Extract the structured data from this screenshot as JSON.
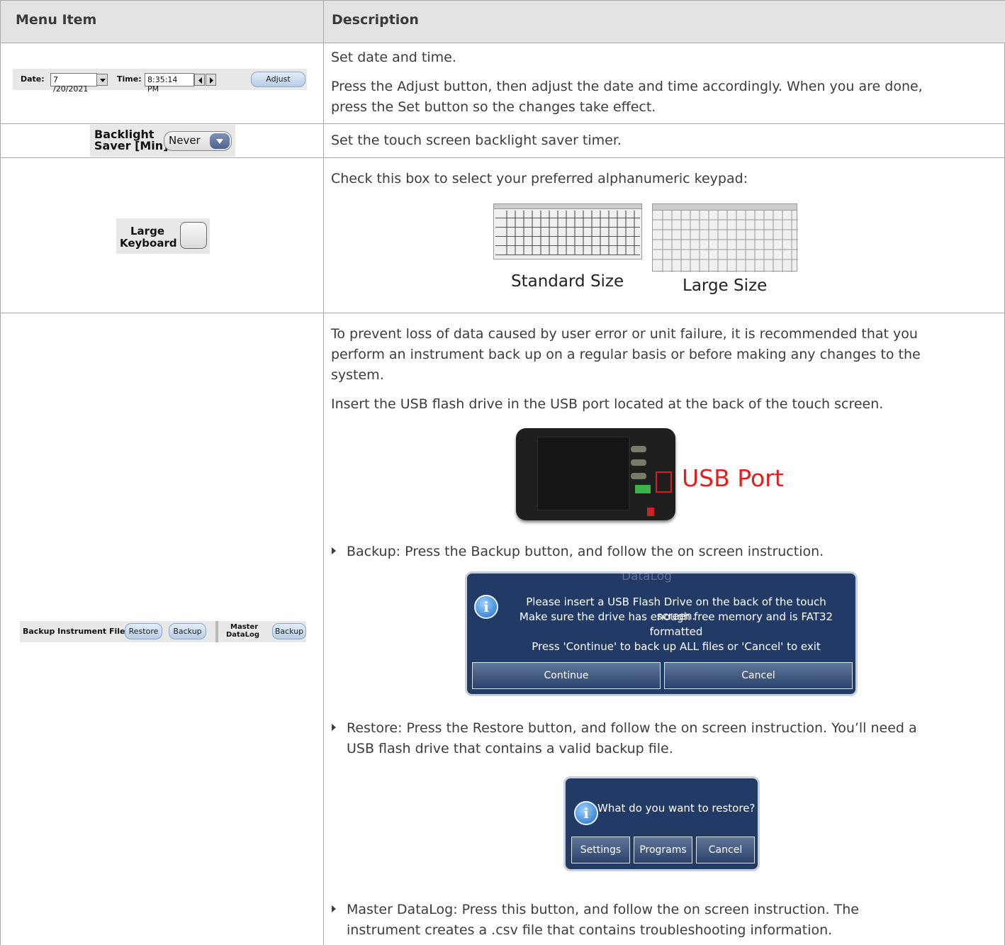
{
  "header": {
    "col1": "Menu Item",
    "col2": "Description"
  },
  "row_datetime": {
    "date_label": "Date:",
    "date_value": "7 /20/2021",
    "time_label": "Time:",
    "time_value": "8:35:14 PM",
    "adjust_label": "Adjust",
    "desc1": "Set date and time.",
    "desc2_line1": "Press the Adjust button, then adjust the date and time accordingly. When you are done,",
    "desc2_line2": "press the Set button so the changes take effect."
  },
  "row_backlight": {
    "label_line1": "Backlight",
    "label_line2": "Saver [Min]:",
    "value": "Never",
    "desc": "Set the touch screen backlight saver timer."
  },
  "row_keyboard": {
    "label_line1": "Large",
    "label_line2": "Keyboard",
    "desc": "Check this box to select your preferred alphanumeric keypad:",
    "standard_caption": "Standard Size",
    "large_caption": "Large Size"
  },
  "row_backup": {
    "label": "Backup Instrument Files:",
    "restore_label": "Restore",
    "backup_label": "Backup",
    "master_line1": "Master",
    "master_line2": "DataLog",
    "master_backup_label": "Backup",
    "p1_line1": "To prevent loss of data caused by user error or unit failure, it is recommended that you",
    "p1_line2": "perform an instrument back up on a regular basis or before making any changes to the",
    "p1_line3": "system.",
    "p2": "Insert the USB flash drive in the USB port located at the back of the touch screen.",
    "usb_label": "USB Port",
    "bullet_backup": "Backup: Press the Backup button, and follow the on screen instruction.",
    "dialog1": {
      "line1": "Please insert a USB Flash Drive on the back of the touch screen.",
      "line2": "Make sure the drive has enough free memory and is FAT32",
      "line3": "formatted",
      "line4": "Press 'Continue' to back up ALL files or 'Cancel' to exit",
      "continue_label": "Continue",
      "cancel_label": "Cancel"
    },
    "bullet_restore_line1": "Restore: Press the Restore button, and follow the on screen instruction. You’ll need a",
    "bullet_restore_line2": "USB flash drive that contains a valid backup file.",
    "dialog2": {
      "question": "What do you want to restore?",
      "settings_label": "Settings",
      "programs_label": "Programs",
      "cancel_label": "Cancel"
    },
    "bullet_master_line1": "Master DataLog: Press this button, and follow the on screen instruction. The",
    "bullet_master_line2": "instrument creates a .csv file that contains troubleshooting information."
  },
  "icons": {
    "bullet": "triangle-bullet-icon",
    "info": "info-icon",
    "dropdown": "chevron-down-icon"
  }
}
